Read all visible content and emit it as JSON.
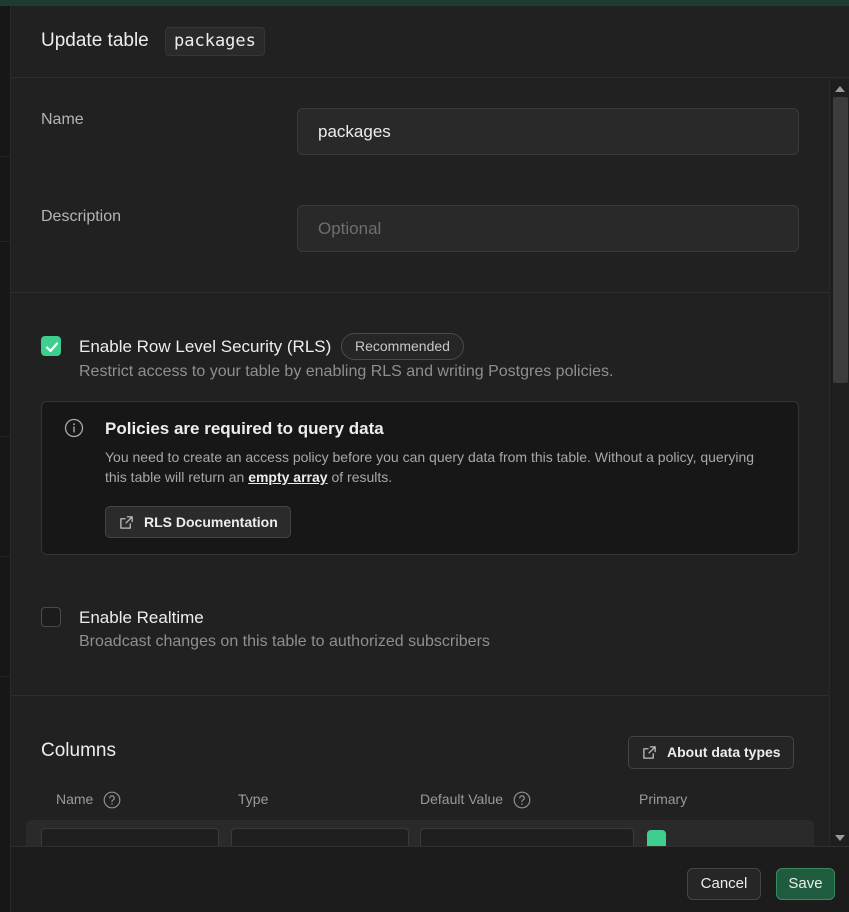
{
  "header": {
    "title": "Update table",
    "table_name": "packages"
  },
  "form": {
    "name_label": "Name",
    "name_value": "packages",
    "description_label": "Description",
    "description_placeholder": "Optional"
  },
  "rls": {
    "label": "Enable Row Level Security (RLS)",
    "badge": "Recommended",
    "description": "Restrict access to your table by enabling RLS and writing Postgres policies.",
    "checked": true
  },
  "alert": {
    "title": "Policies are required to query data",
    "body_before": "You need to create an access policy before you can query data from this table. Without a policy, querying this table will return an ",
    "body_link": "empty array",
    "body_after": " of results.",
    "button": "RLS Documentation"
  },
  "realtime": {
    "label": "Enable Realtime",
    "description": "Broadcast changes on this table to authorized subscribers",
    "checked": false
  },
  "columns": {
    "title": "Columns",
    "about_button": "About data types",
    "headers": {
      "name": "Name",
      "type": "Type",
      "default_value": "Default Value",
      "primary": "Primary"
    }
  },
  "footer": {
    "cancel": "Cancel",
    "save": "Save"
  },
  "colors": {
    "accent": "#3ecf8e",
    "save_bg": "#1f5c3f",
    "panel_bg": "#212121"
  }
}
